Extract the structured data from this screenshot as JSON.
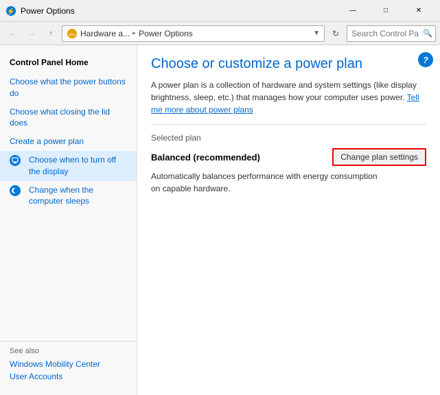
{
  "window": {
    "title": "Power Options",
    "titlebar_icon": "⚡"
  },
  "addressbar": {
    "back_tooltip": "Back",
    "forward_tooltip": "Forward",
    "up_tooltip": "Up",
    "breadcrumb_parent": "Hardware a...",
    "breadcrumb_current": "Power Options",
    "refresh_tooltip": "Refresh",
    "search_placeholder": "Search Control Panel"
  },
  "sidebar": {
    "title": "Control Panel Home",
    "items": [
      {
        "label": "Choose what the power buttons do",
        "icon": "power",
        "active": false
      },
      {
        "label": "Choose what closing the lid does",
        "icon": "power",
        "active": false
      },
      {
        "label": "Create a power plan",
        "icon": null,
        "active": false
      },
      {
        "label": "Choose when to turn off the display",
        "icon": "monitor",
        "active": true
      },
      {
        "label": "Change when the computer sleeps",
        "icon": "moon",
        "active": false
      }
    ],
    "see_also_title": "See also",
    "bottom_links": [
      "Windows Mobility Center",
      "User Accounts"
    ]
  },
  "content": {
    "title": "Choose or customize a power plan",
    "description": "A power plan is a collection of hardware and system settings (like display brightness, sleep, etc.) that manages how your computer uses power.",
    "link_text": "Tell me more about power plans",
    "selected_plan_label": "Selected plan",
    "plan_name": "Balanced (recommended)",
    "plan_desc": "Automatically balances performance with energy consumption on capable hardware.",
    "change_settings_label": "Change plan settings",
    "help_label": "?"
  }
}
